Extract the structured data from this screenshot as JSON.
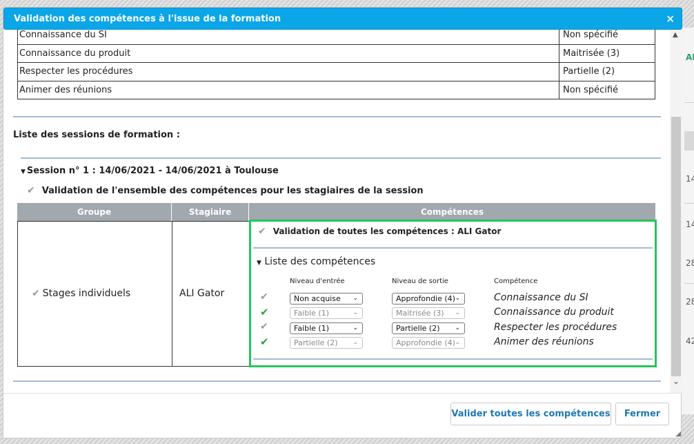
{
  "dialog": {
    "title": "Validation des compétences à l'issue de la formation",
    "close_glyph": "×"
  },
  "competence_table": [
    {
      "name": "Connaissance du SI",
      "level": "Non spécifié"
    },
    {
      "name": "Connaissance du produit",
      "level": "Maitrisée (3)"
    },
    {
      "name": "Respecter les procédures",
      "level": "Partielle (2)"
    },
    {
      "name": "Animer des réunions",
      "level": "Non spécifié"
    }
  ],
  "sessions_label": "Liste des sessions de formation :",
  "session": {
    "header": "Session n° 1 : 14/06/2021 - 14/06/2021 à Toulouse",
    "validate_all_label": "Validation de l'ensemble des compétences pour les stagiaires de la session",
    "columns": {
      "group": "Groupe",
      "trainee": "Stagiaire",
      "competences": "Compétences"
    },
    "group": "Stages individuels",
    "trainee": "ALI Gator",
    "validate_trainee_label": "Validation de toutes les compétences : ALI Gator",
    "list_label": "Liste des compétences",
    "list_columns": {
      "entry": "Niveau d'entrée",
      "exit": "Niveau de sortie",
      "competence": "Compétence"
    },
    "rows": [
      {
        "status_icon": "grey-check-icon",
        "entry": "Non acquise",
        "exit": "Approfondie (4)",
        "name": "Connaissance du SI",
        "disabled": false
      },
      {
        "status_icon": "green-check-icon",
        "entry": "Faible (1)",
        "exit": "Maitrisée (3)",
        "name": "Connaissance du produit",
        "disabled": true
      },
      {
        "status_icon": "grey-check-icon",
        "entry": "Faible (1)",
        "exit": "Partielle (2)",
        "name": "Respecter les procédures",
        "disabled": false
      },
      {
        "status_icon": "green-check-icon",
        "entry": "Partielle (2)",
        "exit": "Approfondie (4)",
        "name": "Animer des réunions",
        "disabled": true
      }
    ]
  },
  "footer": {
    "validate_all_button": "Valider toutes les compétences",
    "close_button": "Fermer"
  },
  "background": {
    "labels": [
      "AL",
      "14",
      "14",
      "28",
      "28",
      "42"
    ]
  },
  "colors": {
    "titlebar": "#0ba6e8",
    "highlight_border": "#22c55e",
    "header_grey": "#a1a8ae",
    "link_blue": "#1f78b4",
    "check_green": "#2ca13b"
  }
}
